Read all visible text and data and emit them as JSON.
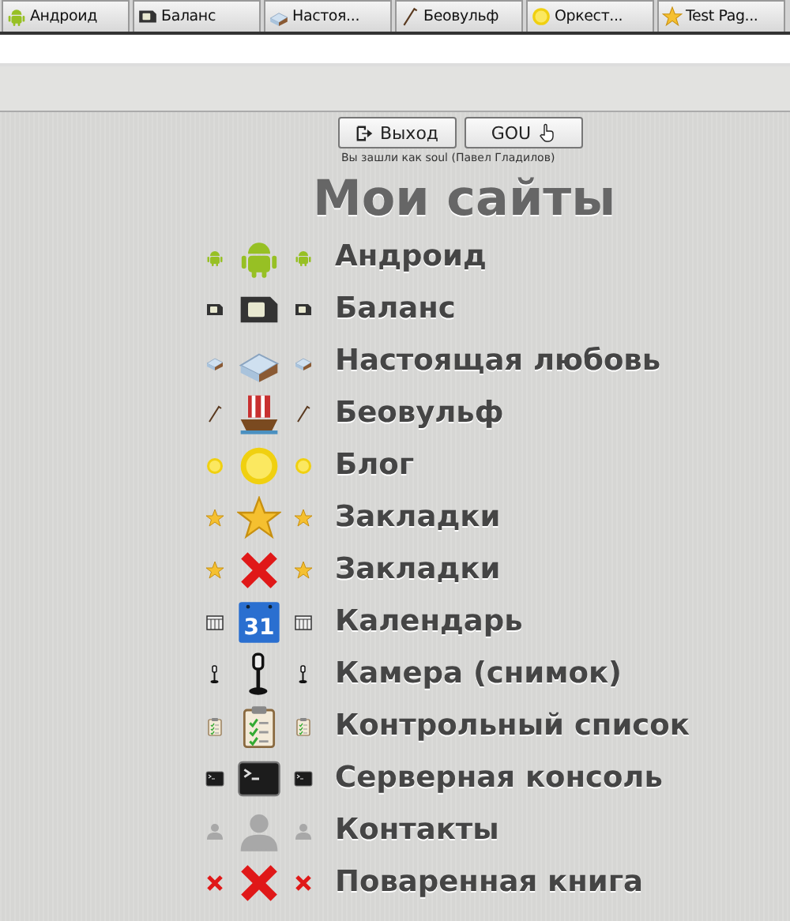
{
  "tabs": [
    {
      "kind": "android",
      "label": "Андроид",
      "selected": false
    },
    {
      "kind": "sim",
      "label": "Баланс",
      "selected": false
    },
    {
      "kind": "bed",
      "label": "Настоя...",
      "selected": false
    },
    {
      "kind": "stick",
      "label": "Беовульф",
      "selected": false
    },
    {
      "kind": "lemon",
      "label": "Оркест...",
      "selected": false
    },
    {
      "kind": "star",
      "label": "Test Pag...",
      "selected": false
    }
  ],
  "buttons": [
    {
      "kind": "exit",
      "label": "Выход"
    },
    {
      "kind": "hand",
      "label": "GOU"
    }
  ],
  "login_note": "Вы зашли как soul (Павел Гладилов)",
  "title": "Мои сайты",
  "sites": [
    {
      "kind": "android",
      "side": {
        "kind": "android"
      },
      "label": "Андроид"
    },
    {
      "kind": "sim",
      "side": {
        "kind": "sim"
      },
      "label": "Баланс"
    },
    {
      "kind": "bed",
      "side": {
        "kind": "bed"
      },
      "label": "Настоящая любовь"
    },
    {
      "kind": "ship",
      "side": {
        "kind": "stick"
      },
      "label": "Беовульф"
    },
    {
      "kind": "lemon",
      "side": {
        "kind": "lemon"
      },
      "label": "Блог"
    },
    {
      "kind": "star",
      "side": {
        "kind": "star"
      },
      "label": "Закладки"
    },
    {
      "kind": "cross",
      "side": {
        "kind": "star"
      },
      "label": "Закладки"
    },
    {
      "kind": "calendar",
      "side": {
        "kind": "calendar"
      },
      "label": "Календарь",
      "icon_text": "31"
    },
    {
      "kind": "lamp",
      "side": {
        "kind": "lamp"
      },
      "label": "Камера (снимок)"
    },
    {
      "kind": "clipboard",
      "side": {
        "kind": "clipboard"
      },
      "label": "Контрольный список"
    },
    {
      "kind": "terminal",
      "side": {
        "kind": "terminal"
      },
      "label": "Серверная консоль"
    },
    {
      "kind": "person",
      "side": {
        "kind": "person"
      },
      "label": "Контакты"
    },
    {
      "kind": "cross",
      "side": {
        "kind": "cross"
      },
      "label": "Поваренная книга"
    }
  ]
}
